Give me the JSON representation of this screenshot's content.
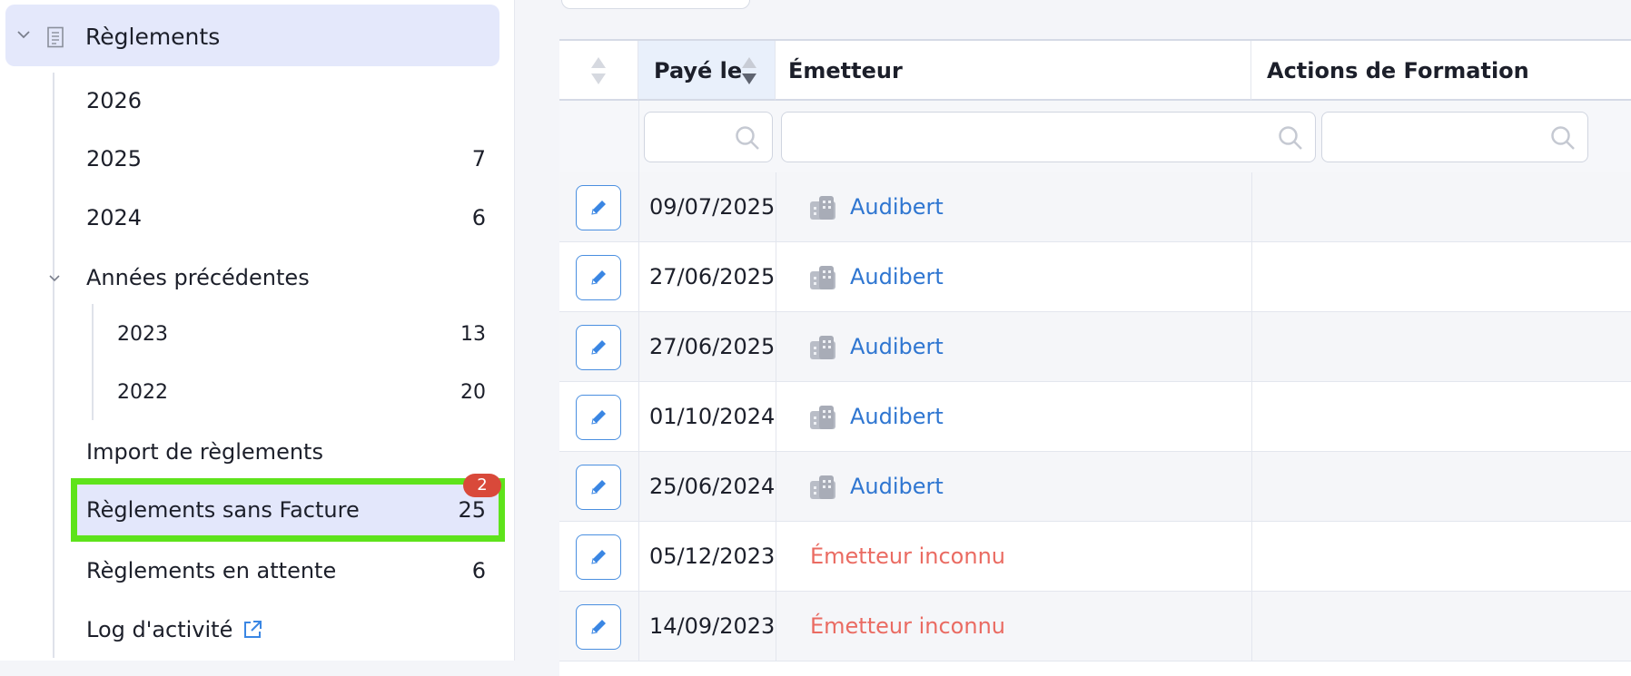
{
  "sidebar": {
    "title": "Règlements",
    "items": [
      {
        "label": "2026",
        "count": ""
      },
      {
        "label": "2025",
        "count": "7"
      },
      {
        "label": "2024",
        "count": "6"
      },
      {
        "label": "Années précédentes",
        "count": ""
      },
      {
        "label": "2023",
        "count": "13"
      },
      {
        "label": "2022",
        "count": "20"
      },
      {
        "label": "Import de règlements",
        "count": ""
      },
      {
        "label": "Règlements sans Facture",
        "count": "25",
        "badge": "2"
      },
      {
        "label": "Règlements en attente",
        "count": "6"
      },
      {
        "label": "Log d'activité",
        "count": ""
      }
    ]
  },
  "table": {
    "headers": [
      "Payé le",
      "Émetteur",
      "Actions de Formation"
    ],
    "rows": [
      {
        "date": "09/07/2025",
        "emitter": "Audibert",
        "known": true
      },
      {
        "date": "27/06/2025",
        "emitter": "Audibert",
        "known": true
      },
      {
        "date": "27/06/2025",
        "emitter": "Audibert",
        "known": true
      },
      {
        "date": "01/10/2024",
        "emitter": "Audibert",
        "known": true
      },
      {
        "date": "25/06/2024",
        "emitter": "Audibert",
        "known": true
      },
      {
        "date": "05/12/2023",
        "emitter": "Émetteur inconnu",
        "known": false
      },
      {
        "date": "14/09/2023",
        "emitter": "Émetteur inconnu",
        "known": false
      }
    ]
  },
  "colors": {
    "selected_highlight": "#5ee31b",
    "badge": "#d9493a",
    "link": "#2f76d1",
    "unknown_emitter": "#ea6b62"
  }
}
